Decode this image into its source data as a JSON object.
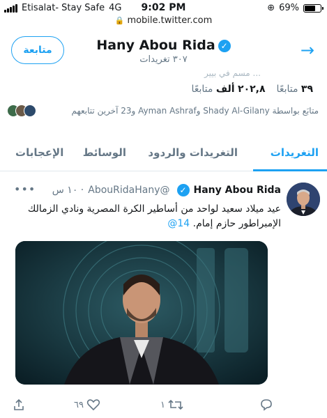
{
  "status_bar": {
    "carrier": "Etisalat- Stay Safe",
    "network": "4G",
    "time": "9:02 PM",
    "battery_pct": "69%",
    "battery_level": 0.69
  },
  "url_bar": {
    "url": "mobile.twitter.com"
  },
  "header": {
    "follow_label": "متابعة",
    "name": "Hany Abou Rida",
    "tweet_count": "٣٠٧ تغريدات",
    "back_icon": "arrow-right-icon",
    "accent": "#1da1f2"
  },
  "profile": {
    "partial_bio": "مسم في بيير ...",
    "following_count": "٣٩",
    "following_label": "متابعًا",
    "followers_count": "٢٠٢,٨",
    "followers_unit": "ألف",
    "followers_label": "متابعًا",
    "followed_by": "متابَع بواسطة Shady Al-Gilany وAyman Ashraf و23 آخرين تتابعهم"
  },
  "tabs": [
    {
      "label": "التغريدات",
      "active": true
    },
    {
      "label": "التغريدات والردود",
      "active": false
    },
    {
      "label": "الوسائط",
      "active": false
    },
    {
      "label": "الإعجابات",
      "active": false
    }
  ],
  "tweet": {
    "name": "Hany Abou Rida",
    "handle": "@AbouRidaHany",
    "time": "١٠ س",
    "more": "•••",
    "text_main": "عيد ميلاد سعيد لواحد من أساطير الكرة المصرية ونادي الزمالك الإمبراطور حازم إمام.",
    "text_mention": "14@",
    "actions": {
      "reply_count": "",
      "retweet_count": "١",
      "like_count": "٦٩",
      "share_icon": "share-icon"
    }
  }
}
